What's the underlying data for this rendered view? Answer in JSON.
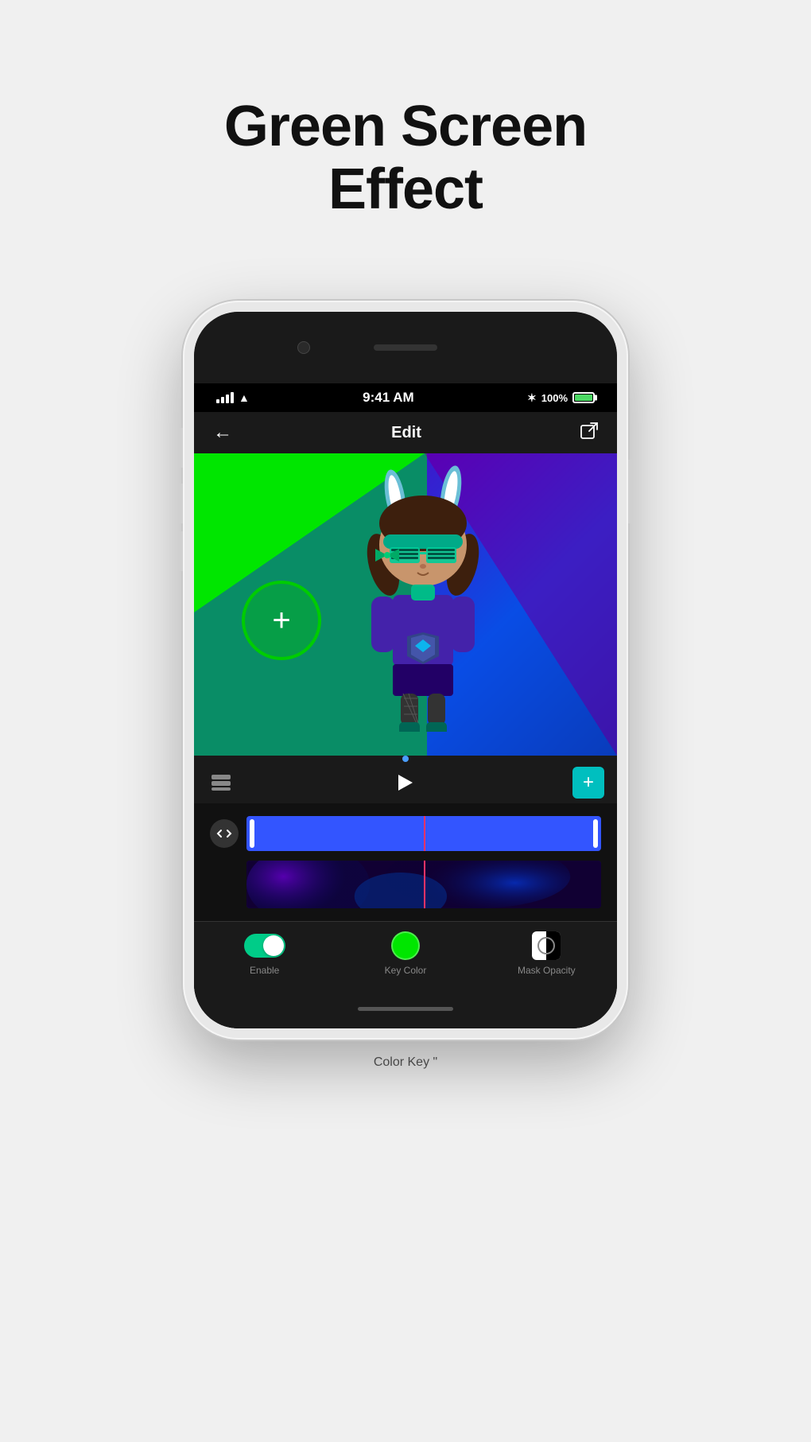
{
  "page": {
    "title": "Green Screen\nEffect",
    "title_line1": "Green Screen",
    "title_line2": "Effect"
  },
  "status_bar": {
    "time": "9:41 AM",
    "battery": "100%",
    "signal": "●●●●",
    "wifi": "wifi"
  },
  "nav": {
    "title": "Edit",
    "back_label": "←",
    "export_label": "⬡"
  },
  "bottom_tabs": {
    "enable_label": "Enable",
    "key_color_label": "Key Color",
    "mask_opacity_label": "Mask Opacity"
  },
  "bottom_bar_text": "Color Key \""
}
